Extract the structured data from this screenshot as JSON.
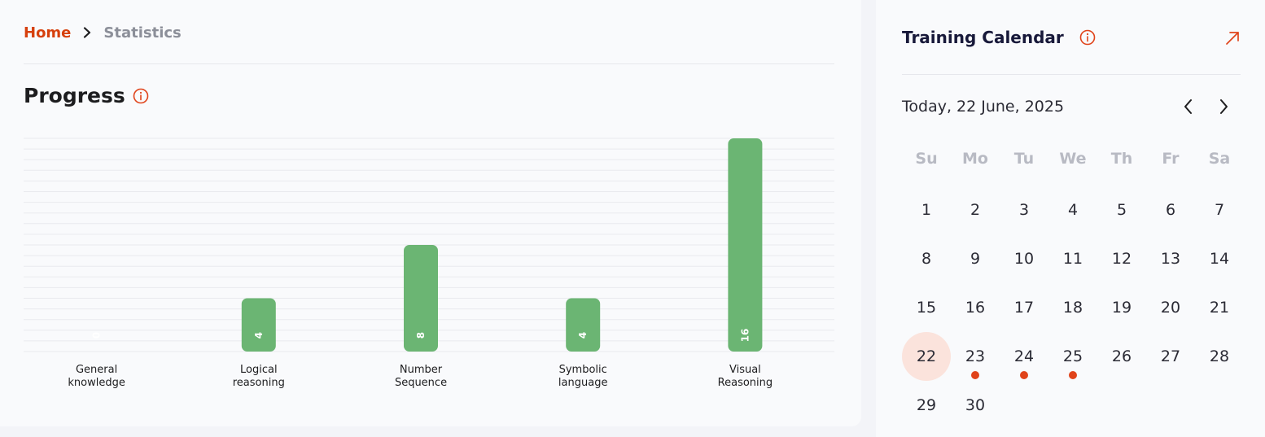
{
  "breadcrumb": {
    "home": "Home",
    "current": "Statistics"
  },
  "progress": {
    "title": "Progress"
  },
  "chart_data": {
    "type": "bar",
    "categories": [
      "General knowledge",
      "Logical reasoning",
      "Number Sequence",
      "Symbolic language",
      "Visual Reasoning"
    ],
    "category_lines": [
      [
        "General",
        "knowledge"
      ],
      [
        "Logical",
        "reasoning"
      ],
      [
        "Number",
        "Sequence"
      ],
      [
        "Symbolic",
        "language"
      ],
      [
        "Visual",
        "Reasoning"
      ]
    ],
    "values": [
      0,
      4,
      8,
      4,
      16
    ],
    "ylim": [
      0,
      16
    ],
    "grid": true,
    "bar_color": "#6bb573",
    "title": "",
    "xlabel": "",
    "ylabel": ""
  },
  "calendar": {
    "title": "Training Calendar",
    "today_label": "Today, 22 June, 2025",
    "weekdays": [
      "Su",
      "Mo",
      "Tu",
      "We",
      "Th",
      "Fr",
      "Sa"
    ],
    "days": [
      1,
      2,
      3,
      4,
      5,
      6,
      7,
      8,
      9,
      10,
      11,
      12,
      13,
      14,
      15,
      16,
      17,
      18,
      19,
      20,
      21,
      22,
      23,
      24,
      25,
      26,
      27,
      28,
      29,
      30
    ],
    "first_weekday_index": 0,
    "selected_day": 22,
    "marked_days": [
      23,
      24,
      25
    ],
    "accent": "#e0431a",
    "selected_bg": "#fbe3dc"
  },
  "icons": {
    "breadcrumb_sep": "chevron-right-icon",
    "info": "info-icon",
    "open": "arrow-up-right-icon",
    "prev": "chevron-left-icon",
    "next": "chevron-right-icon"
  }
}
